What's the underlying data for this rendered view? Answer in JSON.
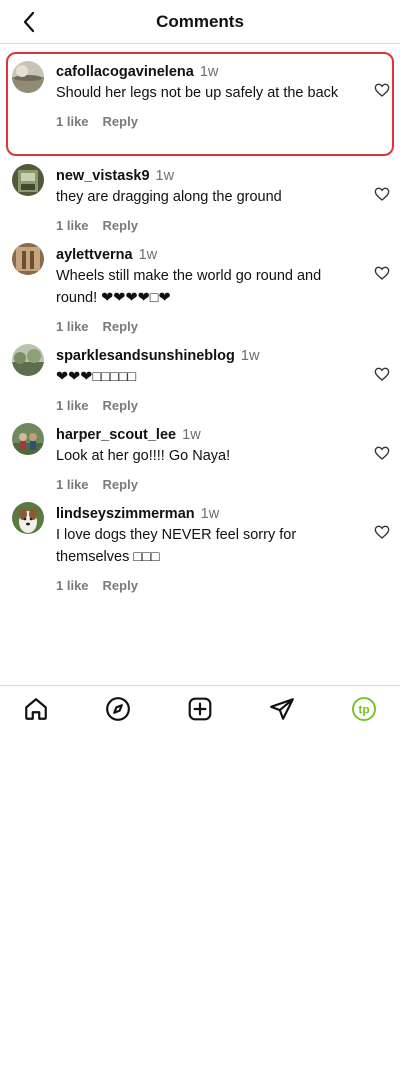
{
  "header": {
    "title": "Comments"
  },
  "comments": [
    {
      "username": "cafollacogavinelena",
      "time": "1w",
      "text": "Should her legs not be up safely at the back",
      "likes": "1 like",
      "reply": "Reply"
    },
    {
      "username": "new_vistask9",
      "time": "1w",
      "text": "they are dragging along the ground",
      "likes": "1 like",
      "reply": "Reply"
    },
    {
      "username": "aylettverna",
      "time": "1w",
      "text": "Wheels still make the world go round and round! ❤❤❤❤□❤",
      "likes": "1 like",
      "reply": "Reply"
    },
    {
      "username": "sparklesandsunshineblog",
      "time": "1w",
      "text": "❤❤❤□□□□□",
      "likes": "1 like",
      "reply": "Reply"
    },
    {
      "username": "harper_scout_lee",
      "time": "1w",
      "text": "Look at her go!!!! Go Naya!",
      "likes": "1 like",
      "reply": "Reply"
    },
    {
      "username": "lindseyszimmerman",
      "time": "1w",
      "text": "I love dogs they NEVER feel sorry for themselves □□□",
      "likes": "1 like",
      "reply": "Reply"
    }
  ],
  "nav": {
    "items": [
      "home-icon",
      "explore-icon",
      "create-icon",
      "messages-icon",
      "profile-avatar"
    ],
    "profile_initials": "tp",
    "accent": "#7cc22a"
  },
  "colors": {
    "highlight": "#e0323c"
  }
}
